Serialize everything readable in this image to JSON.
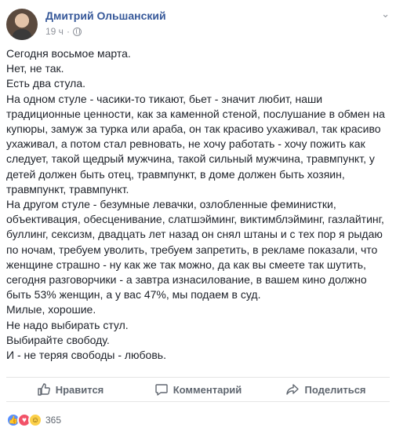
{
  "post": {
    "author": "Дмитрий Ольшанский",
    "time": "19 ч",
    "separator": "·",
    "paragraphs": [
      "Сегодня восьмое марта.",
      "Нет, не так.",
      "Есть два стула.",
      "На одном стуле - часики-то тикают, бьет - значит любит, наши традиционные ценности, как за каменной стеной, послушание в обмен на купюры, замуж за турка или араба, он так красиво ухаживал, так красиво ухаживал, а потом стал ревновать, не хочу работать - хочу пожить как следует, такой щедрый мужчина, такой сильный мужчина, травмпункт, у детей должен быть отец, травмпункт, в доме должен быть хозяин, травмпункт, травмпункт.",
      "На другом стуле - безумные левачки, озлобленные феминистки, объективация, обесценивание, слатшэйминг, виктимблэйминг, газлайтинг, буллинг, сексизм, двадцать лет назад он снял штаны и с тех пор я рыдаю по ночам, требуем уволить, требуем запретить, в рекламе показали, что женщине страшно - ну как же так можно, да как вы смеете так шутить, сегодня разговорчики - а завтра изнасилование, в вашем кино должно быть 53% женщин, а у вас 47%, мы подаем в суд.",
      "Милые, хорошие.",
      "Не надо выбирать стул.",
      "Выбирайте свободу.",
      "И - не теряя свободы - любовь."
    ]
  },
  "actions": {
    "like_label": "Нравится",
    "comment_label": "Комментарий",
    "share_label": "Поделиться"
  },
  "reactions": {
    "icons": [
      "like-icon",
      "love-icon",
      "haha-icon"
    ],
    "count": "365"
  },
  "colors": {
    "author": "#365899",
    "meta": "#90949c",
    "like": "#5890ff",
    "love": "#f25268",
    "haha": "#fcd04a"
  }
}
